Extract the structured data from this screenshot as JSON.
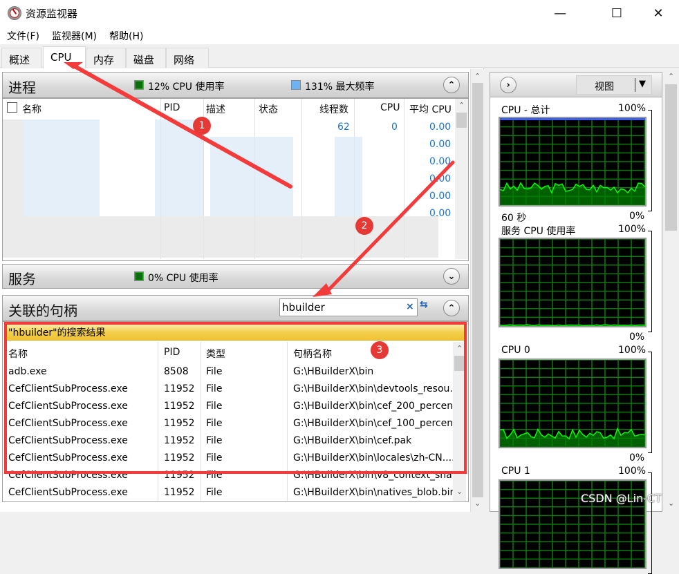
{
  "window": {
    "title": "资源监视器",
    "controls": {
      "minimize": "—",
      "maximize": "☐",
      "close": "✕"
    }
  },
  "menu": [
    "文件(F)",
    "监视器(M)",
    "帮助(H)"
  ],
  "tabs": [
    {
      "label": "概述",
      "active": false
    },
    {
      "label": "CPU",
      "active": true
    },
    {
      "label": "内存",
      "active": false
    },
    {
      "label": "磁盘",
      "active": false
    },
    {
      "label": "网络",
      "active": false
    }
  ],
  "processes": {
    "title": "进程",
    "cpu_usage": "12% CPU 使用率",
    "max_freq": "131% 最大频率",
    "columns": [
      "名称",
      "PID",
      "描述",
      "状态",
      "线程数",
      "CPU",
      "平均 CPU"
    ],
    "visible_values": {
      "first_row_threads": "62",
      "first_row_cpu": "0",
      "avg_cpu": [
        "0.00",
        "0.00",
        "0.00",
        "0.00",
        "0.00",
        "0.00"
      ]
    }
  },
  "services": {
    "title": "服务",
    "cpu_usage": "0% CPU 使用率"
  },
  "handles": {
    "title": "关联的句柄",
    "search_value": "hbuilder",
    "result_banner": "\"hbuilder\"的搜索结果",
    "columns": [
      "名称",
      "PID",
      "类型",
      "句柄名称"
    ],
    "rows": [
      {
        "name": "adb.exe",
        "pid": "8508",
        "type": "File",
        "handle": "G:\\HBuilderX\\bin"
      },
      {
        "name": "CefClientSubProcess.exe",
        "pid": "11952",
        "type": "File",
        "handle": "G:\\HBuilderX\\bin\\devtools_resou..."
      },
      {
        "name": "CefClientSubProcess.exe",
        "pid": "11952",
        "type": "File",
        "handle": "G:\\HBuilderX\\bin\\cef_200_percen..."
      },
      {
        "name": "CefClientSubProcess.exe",
        "pid": "11952",
        "type": "File",
        "handle": "G:\\HBuilderX\\bin\\cef_100_percen..."
      },
      {
        "name": "CefClientSubProcess.exe",
        "pid": "11952",
        "type": "File",
        "handle": "G:\\HBuilderX\\bin\\cef.pak"
      },
      {
        "name": "CefClientSubProcess.exe",
        "pid": "11952",
        "type": "File",
        "handle": "G:\\HBuilderX\\bin\\locales\\zh-CN...."
      },
      {
        "name": "CefClientSubProcess.exe",
        "pid": "11952",
        "type": "File",
        "handle": "G:\\HBuilderX\\bin\\v8_context_sna..."
      },
      {
        "name": "CefClientSubProcess.exe",
        "pid": "11952",
        "type": "File",
        "handle": "G:\\HBuilderX\\bin\\natives_blob.bin"
      }
    ]
  },
  "right_panel": {
    "view_label": "视图",
    "graphs": [
      {
        "title": "CPU - 总计",
        "max": "100%",
        "min": "0%",
        "footer": "60 秒",
        "level": 0.2
      },
      {
        "title": "服务 CPU 使用率",
        "max": "100%",
        "min": "0%",
        "footer": "",
        "level": 0.01
      },
      {
        "title": "CPU 0",
        "max": "100%",
        "min": "0%",
        "footer": "",
        "level": 0.15
      },
      {
        "title": "CPU 1",
        "max": "100%",
        "min": "",
        "footer": "",
        "level": 0.0
      }
    ]
  },
  "annotations": {
    "badges": [
      "1",
      "2",
      "3"
    ]
  },
  "watermark": "CSDN @Lin-CT",
  "colors": {
    "graph_green": "#00ff00",
    "graph_fill": "#006400",
    "annotation_red": "#f33b3b",
    "link_blue": "#1a73c8"
  }
}
